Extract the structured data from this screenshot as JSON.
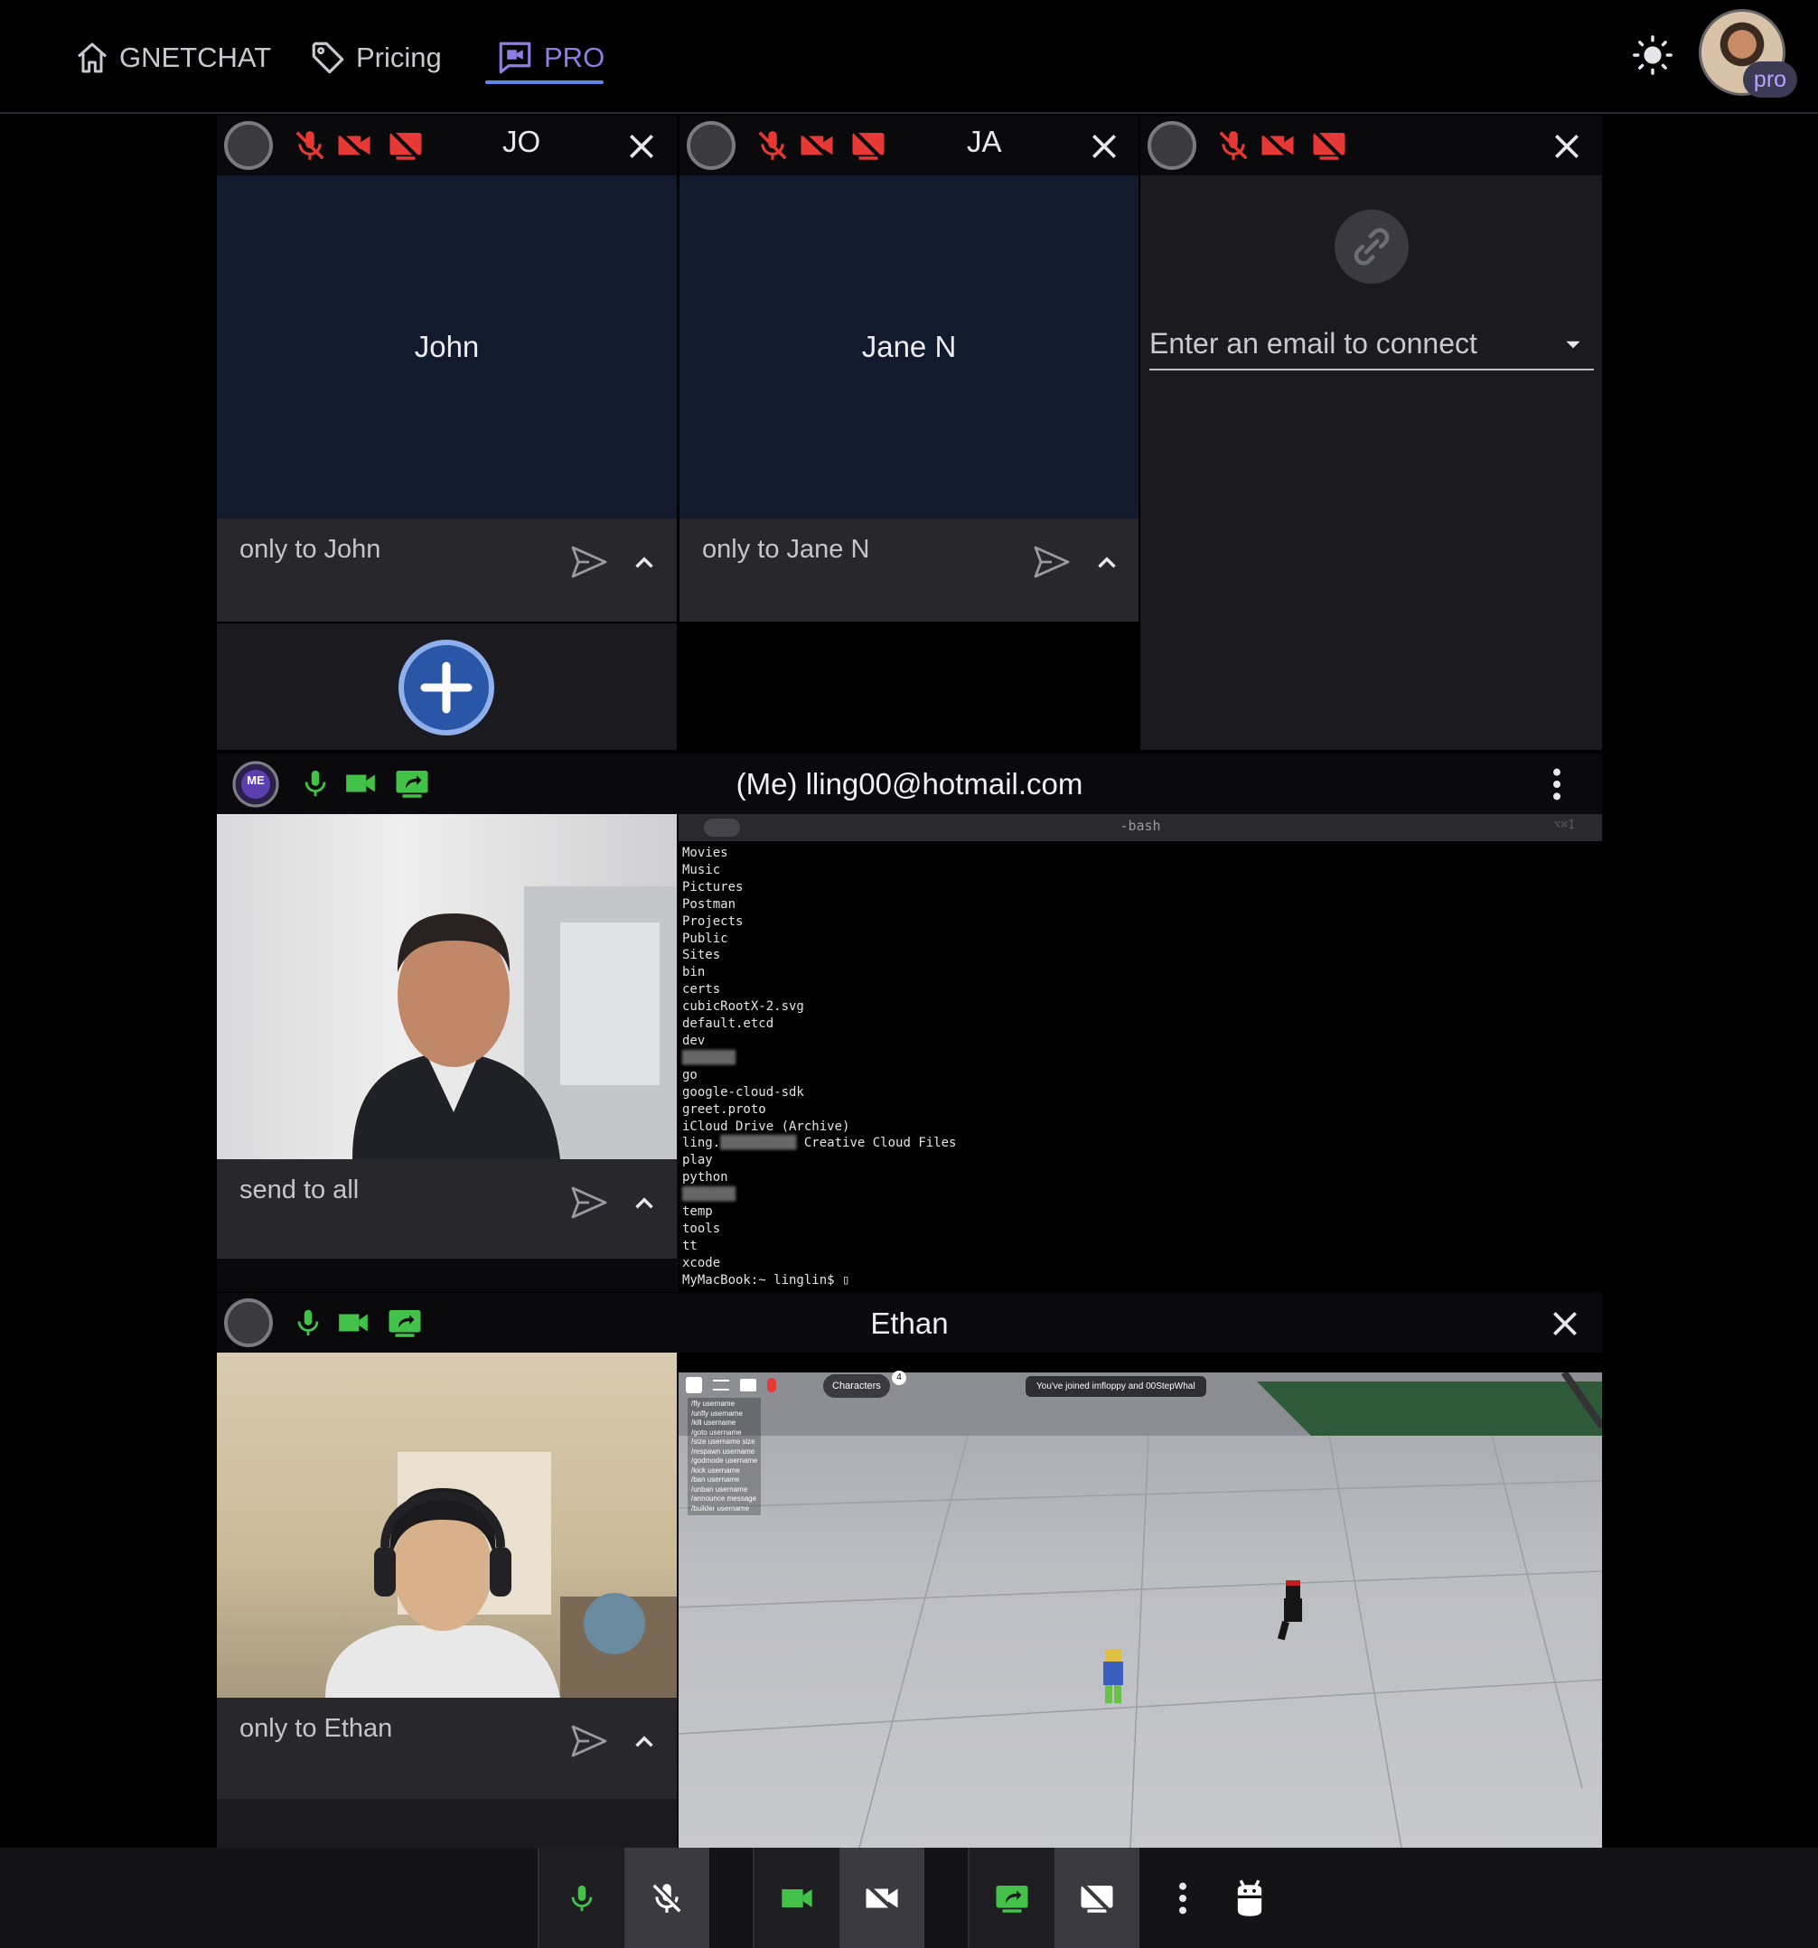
{
  "nav": {
    "home_label": "GNETCHAT",
    "pricing_label": "Pricing",
    "pro_label": "PRO",
    "avatar_badge": "pro"
  },
  "peers": [
    {
      "initials": "JO",
      "name": "John",
      "chat_placeholder": "only to John"
    },
    {
      "initials": "JA",
      "name": "Jane N",
      "chat_placeholder": "only to Jane N"
    }
  ],
  "connect": {
    "placeholder": "Enter an email to connect"
  },
  "me": {
    "badge": "ME",
    "title": "(Me) lling00@hotmail.com",
    "chat_placeholder": "send to all"
  },
  "terminal": {
    "title": "-bash",
    "shortcut": "⌥⌘1",
    "lines": [
      "Movies",
      "Music",
      "Pictures",
      "Postman",
      "Projects",
      "Public",
      "Sites",
      "bin",
      "certs",
      "cubicRootX-2.svg",
      "default.etcd",
      "dev",
      "go",
      "google-cloud-sdk",
      "greet.proto",
      "iCloud Drive (Archive)",
      "Creative Cloud Files",
      "play",
      "python",
      "temp",
      "tools",
      "tt",
      "xcode"
    ],
    "prompt": "MyMacBook:~ linglin$ ▯"
  },
  "ethan": {
    "name": "Ethan",
    "chat_placeholder": "only to Ethan"
  },
  "game": {
    "characters_label": "Characters",
    "characters_count": "4",
    "join_message": "You've joined imfloppy and 00StepWhal",
    "commands": [
      "/fly username",
      "/unfly username",
      "/kill username",
      "/goto username",
      "/size username size",
      "/respawn username",
      "/godmode username",
      "/kick username",
      "/ban username",
      "/unban username",
      "/announce message",
      "/builder username"
    ]
  },
  "colors": {
    "accent": "#8f7ee8",
    "underline": "#5a8ae6",
    "mute_red": "#e53935",
    "active_green": "#43c24a",
    "add_button": "#2a56a8"
  }
}
